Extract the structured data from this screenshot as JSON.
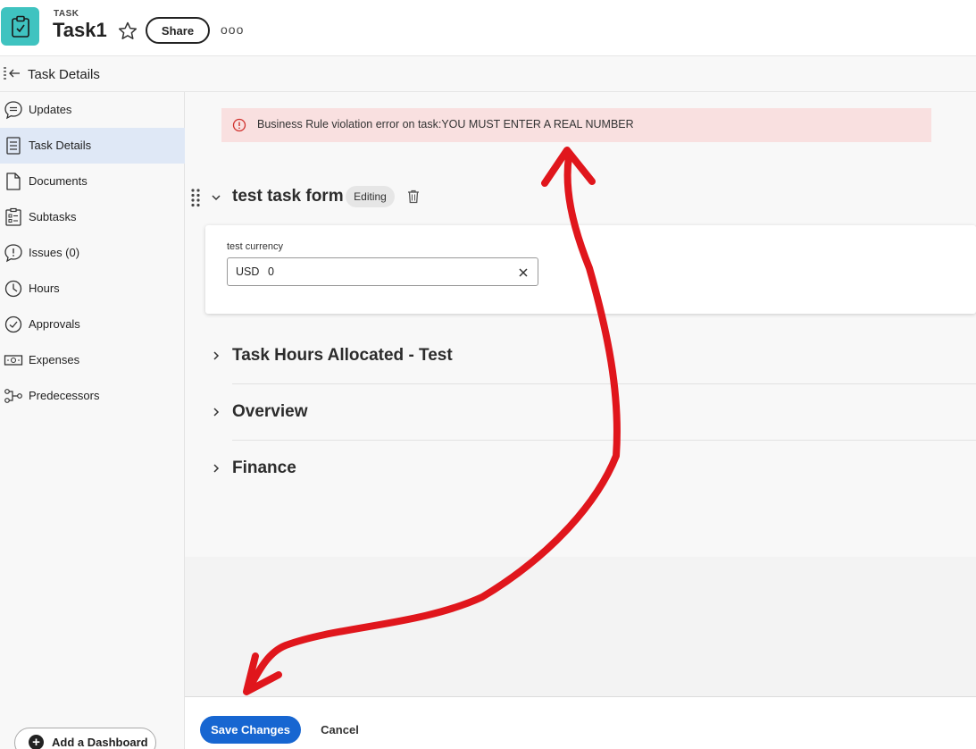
{
  "header": {
    "object_type": "TASK",
    "title": "Task1",
    "share_label": "Share",
    "more_label": "ooo"
  },
  "subheader": {
    "title": "Task Details"
  },
  "sidebar": {
    "items": [
      {
        "label": "Updates",
        "icon": "chat-bubble-icon"
      },
      {
        "label": "Task Details",
        "icon": "document-lines-icon",
        "active": true
      },
      {
        "label": "Documents",
        "icon": "file-icon"
      },
      {
        "label": "Subtasks",
        "icon": "checklist-icon"
      },
      {
        "label": "Issues (0)",
        "icon": "alert-bubble-icon"
      },
      {
        "label": "Hours",
        "icon": "clock-icon"
      },
      {
        "label": "Approvals",
        "icon": "check-circle-icon"
      },
      {
        "label": "Expenses",
        "icon": "money-icon"
      },
      {
        "label": "Predecessors",
        "icon": "flow-icon"
      }
    ],
    "add_dashboard_label": "Add a Dashboard"
  },
  "error": {
    "message": "Business Rule violation error on task:YOU MUST ENTER A REAL NUMBER",
    "color": "#f9e0e0"
  },
  "form": {
    "title": "test task form",
    "status_badge": "Editing",
    "field": {
      "label": "test currency",
      "currency": "USD",
      "value": "0"
    }
  },
  "sections": [
    {
      "title": "Task Hours Allocated - Test"
    },
    {
      "title": "Overview"
    },
    {
      "title": "Finance"
    }
  ],
  "footer": {
    "save_label": "Save Changes",
    "cancel_label": "Cancel"
  },
  "colors": {
    "accent": "#1766d1",
    "app_icon": "#3fc3c0",
    "annotation": "#e0161c"
  }
}
